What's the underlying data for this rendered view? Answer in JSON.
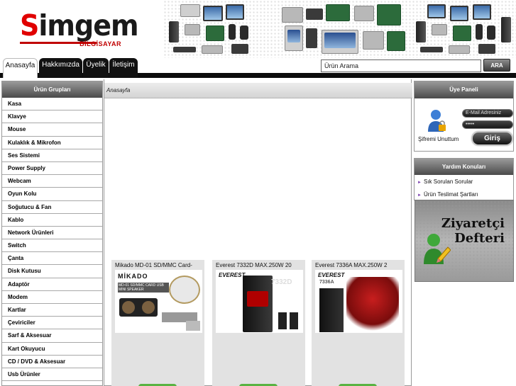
{
  "brand": {
    "name_first": "S",
    "name_rest": "imgem",
    "sub": "BİLGİSAYAR"
  },
  "nav": {
    "tabs": [
      {
        "label": "Anasayfa",
        "active": true
      },
      {
        "label": "Hakkımızda",
        "active": false
      },
      {
        "label": "Üyelik",
        "active": false
      },
      {
        "label": "İletişim",
        "active": false
      }
    ],
    "search_value": "Ürün Arama",
    "search_button": "ARA"
  },
  "categories": {
    "title": "Ürün Grupları",
    "items": [
      "Kasa",
      "Klavye",
      "Mouse",
      "Kulaklık & Mikrofon",
      "Ses Sistemi",
      "Power Supply",
      "Webcam",
      "Oyun Kolu",
      "Soğutucu & Fan",
      "Kablo",
      "Network Ürünleri",
      "Switch",
      "Çanta",
      "Disk Kutusu",
      "Adaptör",
      "Modem",
      "Kartlar",
      "Çeviriciler",
      "Sarf & Aksesuar",
      "Kart Okuyucu",
      "CD / DVD & Aksesuar",
      "Usb Ürünler"
    ]
  },
  "breadcrumb": "Anasayfa",
  "products": [
    {
      "name": "Mikado MD-01 SD/MMC Card-",
      "image_text": "MİKADO",
      "image_caption": "MD-01 SD/MMC CARD USB MINI SPEAKER"
    },
    {
      "name": "Everest 7332D MAX.250W 20",
      "image_text": "EVEREST",
      "image_model": "7332D"
    },
    {
      "name": "Everest 7336A MAX.250W 2",
      "image_text": "EVEREST",
      "image_model": "7336A"
    }
  ],
  "member_panel": {
    "title": "Üye Paneli",
    "email_placeholder": "E-Mail Adresiniz",
    "password_masked": "•••••",
    "login_button": "Giriş",
    "forgot_link": "Şifremi Unuttum"
  },
  "help_panel": {
    "title": "Yardım Konuları",
    "links": [
      "Sık Sorulan Sorular",
      "Ürün Teslimat Şartları"
    ]
  },
  "guestbook": {
    "line1": "Ziyaretçi",
    "line2": "Defteri"
  },
  "colors": {
    "accent_red": "#e00000",
    "nav_black": "#111111",
    "panel_gray": "#6e6e6e",
    "button_green": "#59b342"
  }
}
